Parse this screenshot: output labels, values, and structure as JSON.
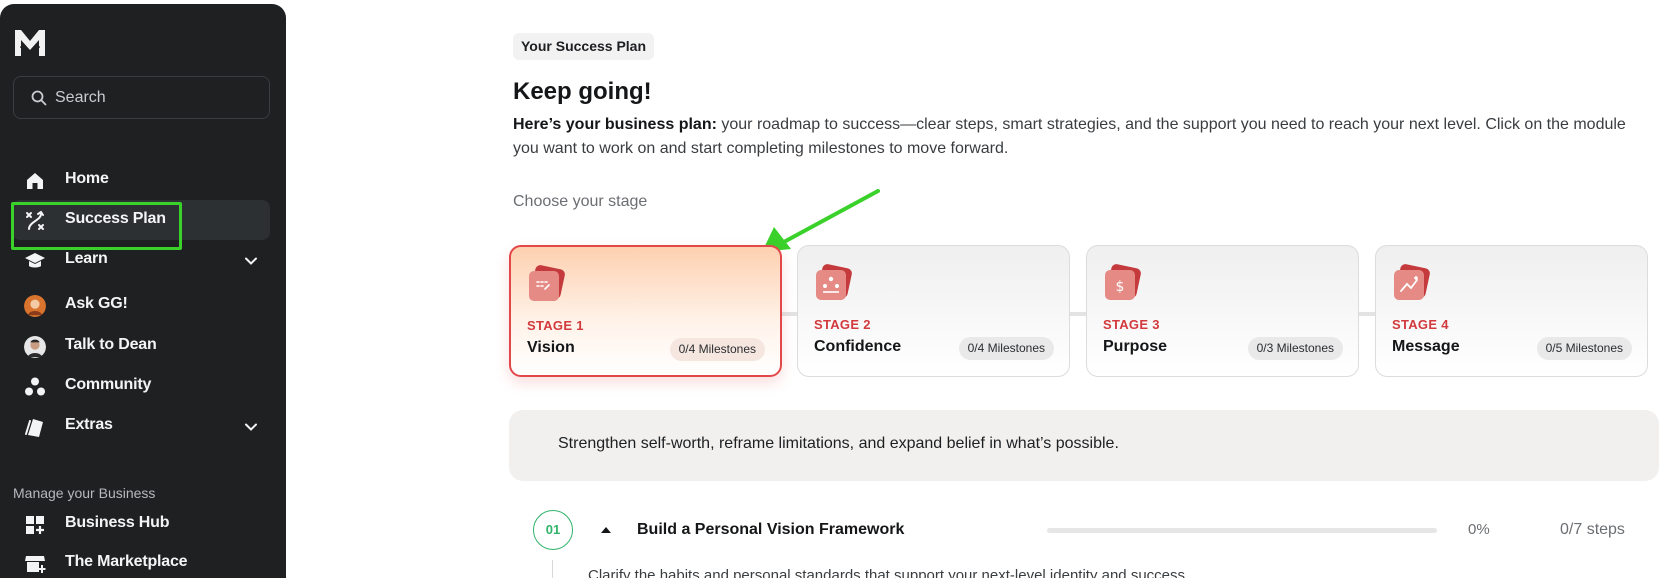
{
  "sidebar": {
    "search_placeholder": "Search",
    "items": [
      {
        "label": "Home",
        "icon": "home-icon"
      },
      {
        "label": "Success Plan",
        "icon": "route-icon",
        "active": true
      },
      {
        "label": "Learn",
        "icon": "graduation-cap-icon",
        "expandable": true
      },
      {
        "label": "Ask GG!",
        "icon": "avatar"
      },
      {
        "label": "Talk to Dean",
        "icon": "avatar"
      },
      {
        "label": "Community",
        "icon": "community-icon"
      },
      {
        "label": "Extras",
        "icon": "extras-icon",
        "expandable": true
      }
    ],
    "section_label": "Manage your Business",
    "business_items": [
      {
        "label": "Business Hub",
        "icon": "grid-plus-icon"
      },
      {
        "label": "The Marketplace",
        "icon": "store-icon"
      }
    ]
  },
  "main": {
    "pill": "Your Success Plan",
    "title": "Keep going!",
    "intro_bold": "Here’s your business plan:",
    "intro_rest": " your roadmap to success—clear steps, smart strategies, and the support you need to reach your next level. Click on the module you want to work on and start completing milestones to move forward.",
    "choose_label": "Choose your stage",
    "stages": [
      {
        "stage": "STAGE 1",
        "name": "Vision",
        "milestones": "0/4 Milestones",
        "active": true
      },
      {
        "stage": "STAGE 2",
        "name": "Confidence",
        "milestones": "0/4 Milestones"
      },
      {
        "stage": "STAGE 3",
        "name": "Purpose",
        "milestones": "0/3 Milestones"
      },
      {
        "stage": "STAGE 4",
        "name": "Message",
        "milestones": "0/5 Milestones"
      }
    ],
    "stage_description": "Strengthen self-worth, reframe limitations, and expand belief in what’s possible.",
    "module": {
      "number": "01",
      "title": "Build a Personal Vision Framework",
      "progress": 0,
      "percent_label": "0%",
      "steps_label": "0/7 steps",
      "subtitle": "Clarify the habits and personal standards that support your next-level identity and success."
    }
  },
  "colors": {
    "sidebar_bg": "#1e2022",
    "accent_red": "#d23a3d",
    "accent_green": "#2fb36a",
    "highlight_green": "#3ad12b"
  }
}
